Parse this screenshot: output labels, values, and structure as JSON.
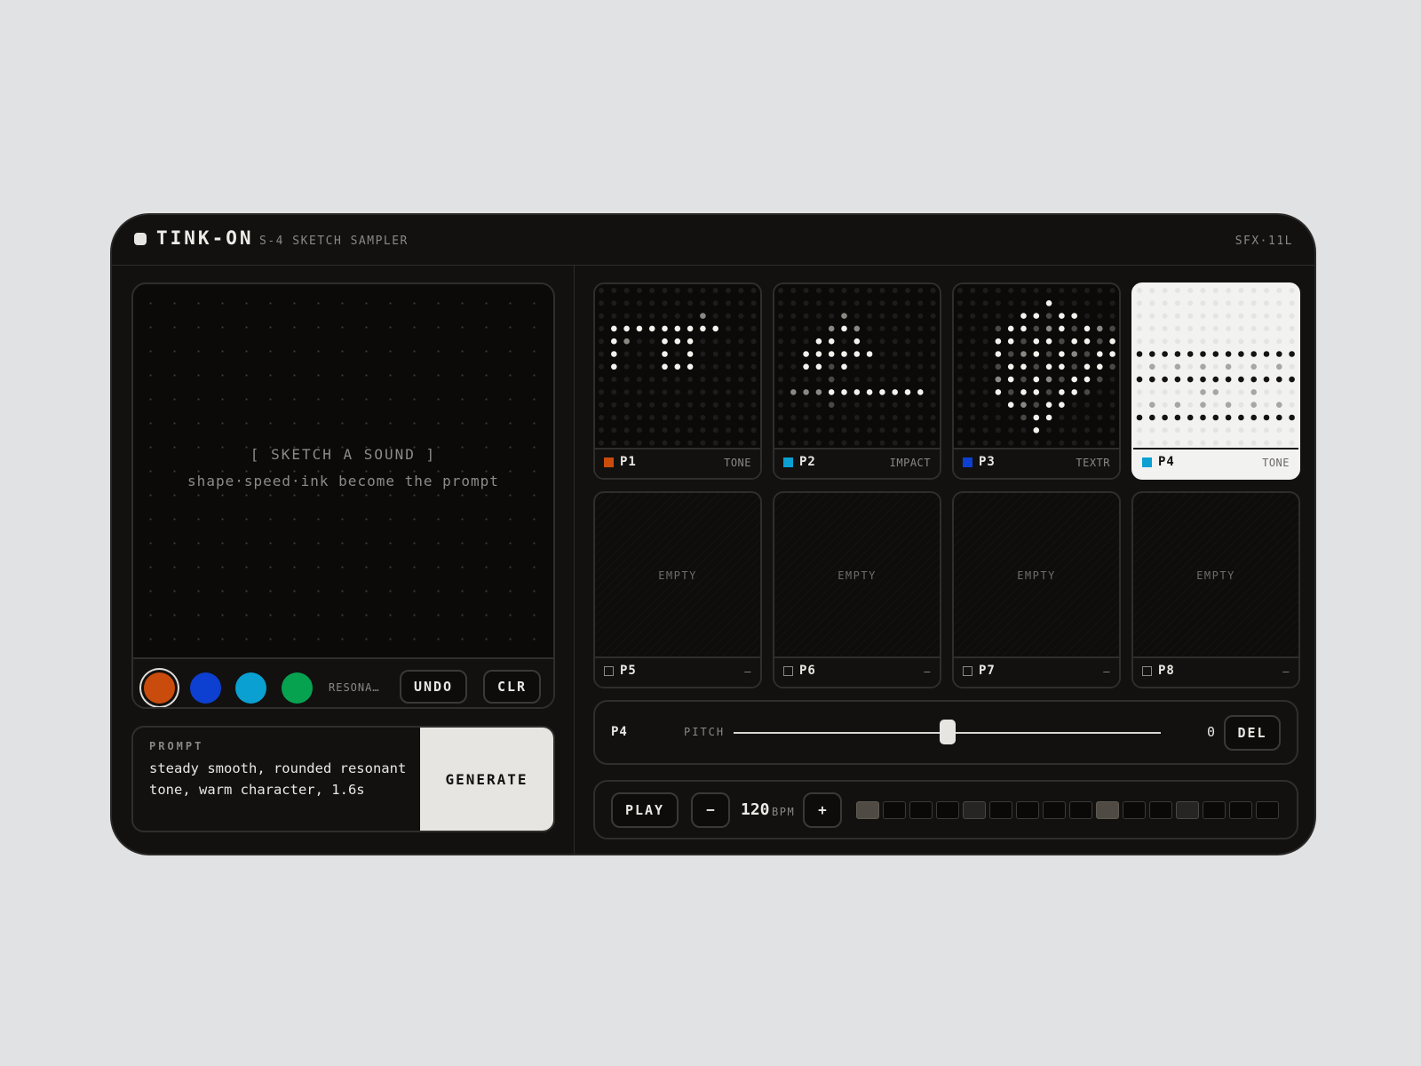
{
  "header": {
    "brand": "TINK-ON",
    "model": "S-4 SKETCH SAMPLER",
    "code": "SFX·11L"
  },
  "sketch": {
    "title": "[ SKETCH A SOUND ]",
    "subtitle": "shape·speed·ink become the prompt",
    "colors": [
      {
        "name": "orange-swatch",
        "hex": "#c94c0c",
        "selected": true
      },
      {
        "name": "blue-swatch",
        "hex": "#0d3fd1",
        "selected": false
      },
      {
        "name": "cyan-swatch",
        "hex": "#0aa0d2",
        "selected": false
      },
      {
        "name": "green-swatch",
        "hex": "#06a250",
        "selected": false
      }
    ],
    "color_label": "RESONA…",
    "undo_label": "UNDO",
    "clear_label": "CLR"
  },
  "prompt": {
    "label": "PROMPT",
    "text": "steady smooth, rounded resonant tone, warm character, 1.6s",
    "generate_label": "GENERATE"
  },
  "pads": [
    {
      "name": "P1",
      "type": "TONE",
      "color": "#c94c0c",
      "state": "filled"
    },
    {
      "name": "P2",
      "type": "IMPACT",
      "color": "#0aa0d2",
      "state": "filled"
    },
    {
      "name": "P3",
      "type": "TEXTR",
      "color": "#0d3fd1",
      "state": "filled"
    },
    {
      "name": "P4",
      "type": "TONE",
      "color": "#0aa0d2",
      "state": "active"
    },
    {
      "name": "P5",
      "type": "—",
      "state": "empty",
      "empty_label": "EMPTY"
    },
    {
      "name": "P6",
      "type": "—",
      "state": "empty",
      "empty_label": "EMPTY"
    },
    {
      "name": "P7",
      "type": "—",
      "state": "empty",
      "empty_label": "EMPTY"
    },
    {
      "name": "P8",
      "type": "—",
      "state": "empty",
      "empty_label": "EMPTY"
    }
  ],
  "pitch": {
    "pad": "P4",
    "label": "PITCH",
    "value": "0",
    "position": 0.5,
    "delete_label": "DEL"
  },
  "transport": {
    "play_label": "PLAY",
    "minus_label": "−",
    "plus_label": "+",
    "bpm": "120",
    "bpm_unit": "BPM",
    "steps": [
      "on",
      "off",
      "off",
      "off",
      "mark",
      "off",
      "off",
      "off",
      "off",
      "on",
      "off",
      "off",
      "mark",
      "off",
      "off",
      "off"
    ]
  }
}
